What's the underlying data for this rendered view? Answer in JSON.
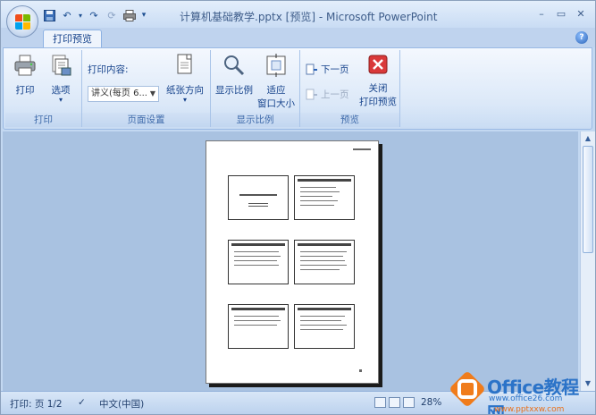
{
  "window": {
    "title": "计算机基础教学.pptx [预览] - Microsoft PowerPoint",
    "minimize": "–",
    "maximize": "▭",
    "close": "✕"
  },
  "qat": {
    "items": [
      {
        "name": "save-icon",
        "glyph": "💾"
      },
      {
        "name": "undo-icon",
        "glyph": "↶"
      },
      {
        "name": "undo-dropdown-icon",
        "glyph": "▾"
      },
      {
        "name": "redo-icon",
        "glyph": "↷"
      },
      {
        "name": "repeat-icon",
        "glyph": "⟳"
      },
      {
        "name": "print-icon",
        "glyph": "⎙"
      },
      {
        "name": "customize-qat-icon",
        "glyph": "▾"
      }
    ]
  },
  "tabs": {
    "active": "打印预览"
  },
  "ribbon": {
    "groups": [
      {
        "label": "打印"
      },
      {
        "label": "页面设置"
      },
      {
        "label": "显示比例"
      },
      {
        "label": "预览"
      }
    ],
    "print_btn": "打印",
    "options_btn": "选项",
    "print_what_label": "打印内容:",
    "print_what_value": "讲义(每页 6...",
    "orientation_btn": "纸张方向",
    "zoom_btn": "显示比例",
    "fit_line1": "适应",
    "fit_line2": "窗口大小",
    "next_page": "下一页",
    "prev_page": "上一页",
    "close_line1": "关闭",
    "close_line2": "打印预览"
  },
  "status": {
    "page": "打印: 页 1/2",
    "language": "中文(中国)",
    "zoom": "28%"
  },
  "watermark": {
    "brand": "Office教程网",
    "url": "www.office26.com",
    "url2": "www.pptxxw.com"
  },
  "colors": {
    "accent": "#15428b",
    "ribbon": "#dbe8f8",
    "workarea": "#a9c2e1",
    "close_red": "#d9393a"
  }
}
